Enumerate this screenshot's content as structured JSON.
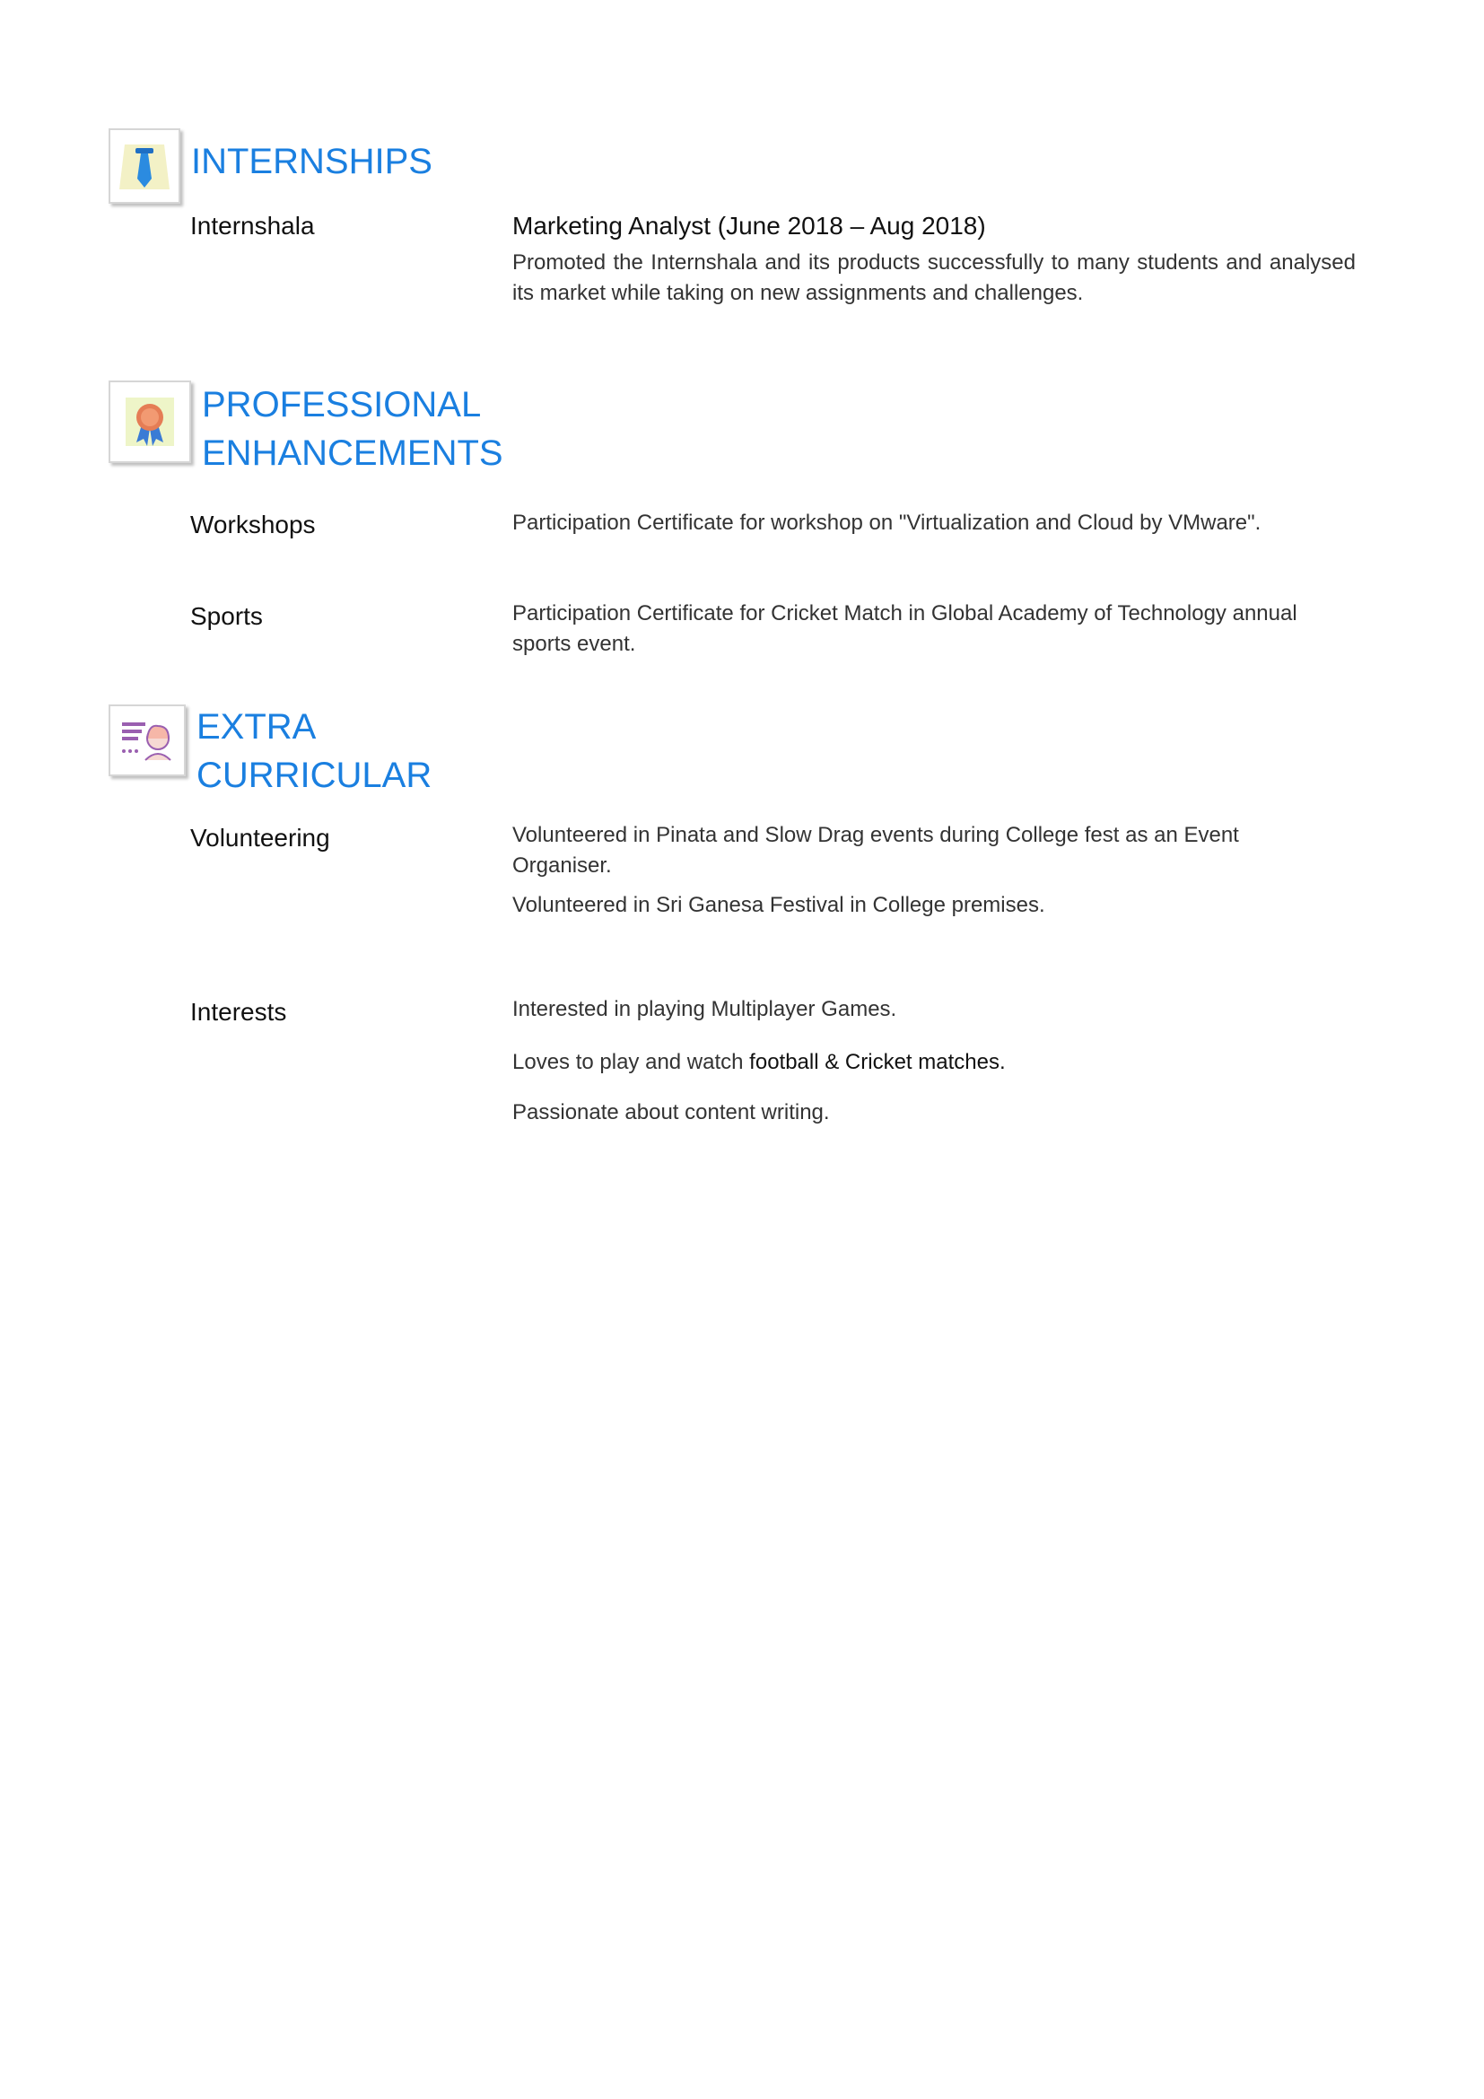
{
  "sections": {
    "internships": {
      "title": "INTERNSHIPS",
      "icon": "tie-icon",
      "entries": [
        {
          "label": "Internshala",
          "role": "Marketing Analyst (June 2018 – Aug 2018)",
          "description": "Promoted the Internshala and its products successfully to many students and analysed its market while taking on new assignments and challenges."
        }
      ]
    },
    "professional": {
      "title_line1": "PROFESSIONAL",
      "title_line2": "ENHANCEMENTS",
      "icon": "award-ribbon-icon",
      "entries": [
        {
          "label": "Workshops",
          "description": "Participation Certificate for workshop on \"Virtualization and Cloud by VMware\"."
        },
        {
          "label": "Sports",
          "description": "Participation Certificate for Cricket Match in Global Academy of Technology annual sports event."
        }
      ]
    },
    "extra": {
      "title_line1": "EXTRA",
      "title_line2": "CURRICULAR",
      "icon": "profile-card-icon",
      "entries": [
        {
          "label": "Volunteering",
          "lines": [
            "Volunteered in Pinata and Slow Drag events during College fest as an Event Organiser.",
            "Volunteered in Sri Ganesa Festival in College premises."
          ]
        },
        {
          "label": "Interests",
          "line1": "Interested in playing Multiplayer Games.",
          "line2_prefix": "Loves to play and watch ",
          "line2_emphasis": "football & Cricket matches.",
          "line3": "Passionate about content writing."
        }
      ]
    }
  },
  "colors": {
    "heading": "#1a7fe0",
    "body_text": "#333333",
    "label_text": "#111111"
  }
}
